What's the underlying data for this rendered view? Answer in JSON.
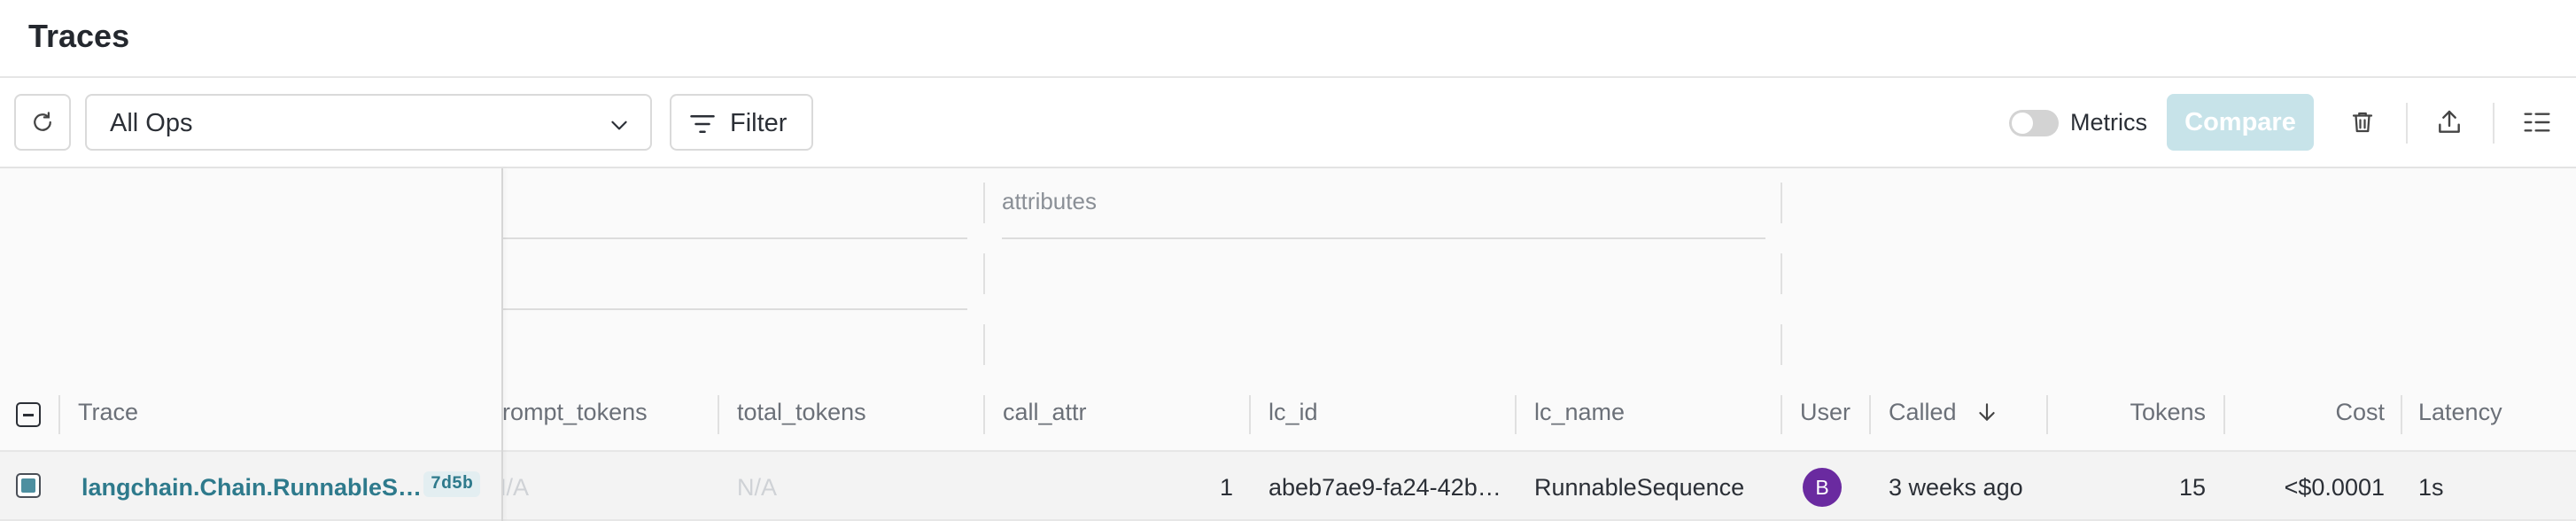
{
  "page": {
    "title": "Traces"
  },
  "toolbar": {
    "refresh_icon": "refresh-icon",
    "ops_select_value": "All Ops",
    "filter_label": "Filter",
    "metrics_label": "Metrics",
    "metrics_enabled": false,
    "compare_label": "Compare",
    "delete_icon": "trash-icon",
    "export_icon": "export-icon",
    "columns_icon": "columns-icon"
  },
  "grid": {
    "group_label": "attributes",
    "columns": {
      "trace": "Trace",
      "prompt_tokens": "prompt_tokens",
      "total_tokens": "total_tokens",
      "call_attr": "call_attr",
      "lc_id": "lc_id",
      "lc_name": "lc_name",
      "user": "User",
      "called": "Called",
      "tokens": "Tokens",
      "cost": "Cost",
      "latency": "Latency"
    },
    "sort_icon": "arrow-down-icon",
    "rows": [
      {
        "trace": "langchain.Chain.RunnableS…",
        "trace_id": "7d5b",
        "prompt_tokens": "N/A",
        "total_tokens": "N/A",
        "call_attr": "1",
        "lc_id": "abeb7ae9-fa24-42b…",
        "lc_name": "RunnableSequence",
        "user_initial": "B",
        "called": "3 weeks ago",
        "tokens": "15",
        "cost": "<$0.0001",
        "latency": "1s"
      }
    ]
  },
  "colors": {
    "accent": "#2e7a8c",
    "compare_disabled": "#c7e3e9",
    "avatar": "#6a2aa0"
  }
}
